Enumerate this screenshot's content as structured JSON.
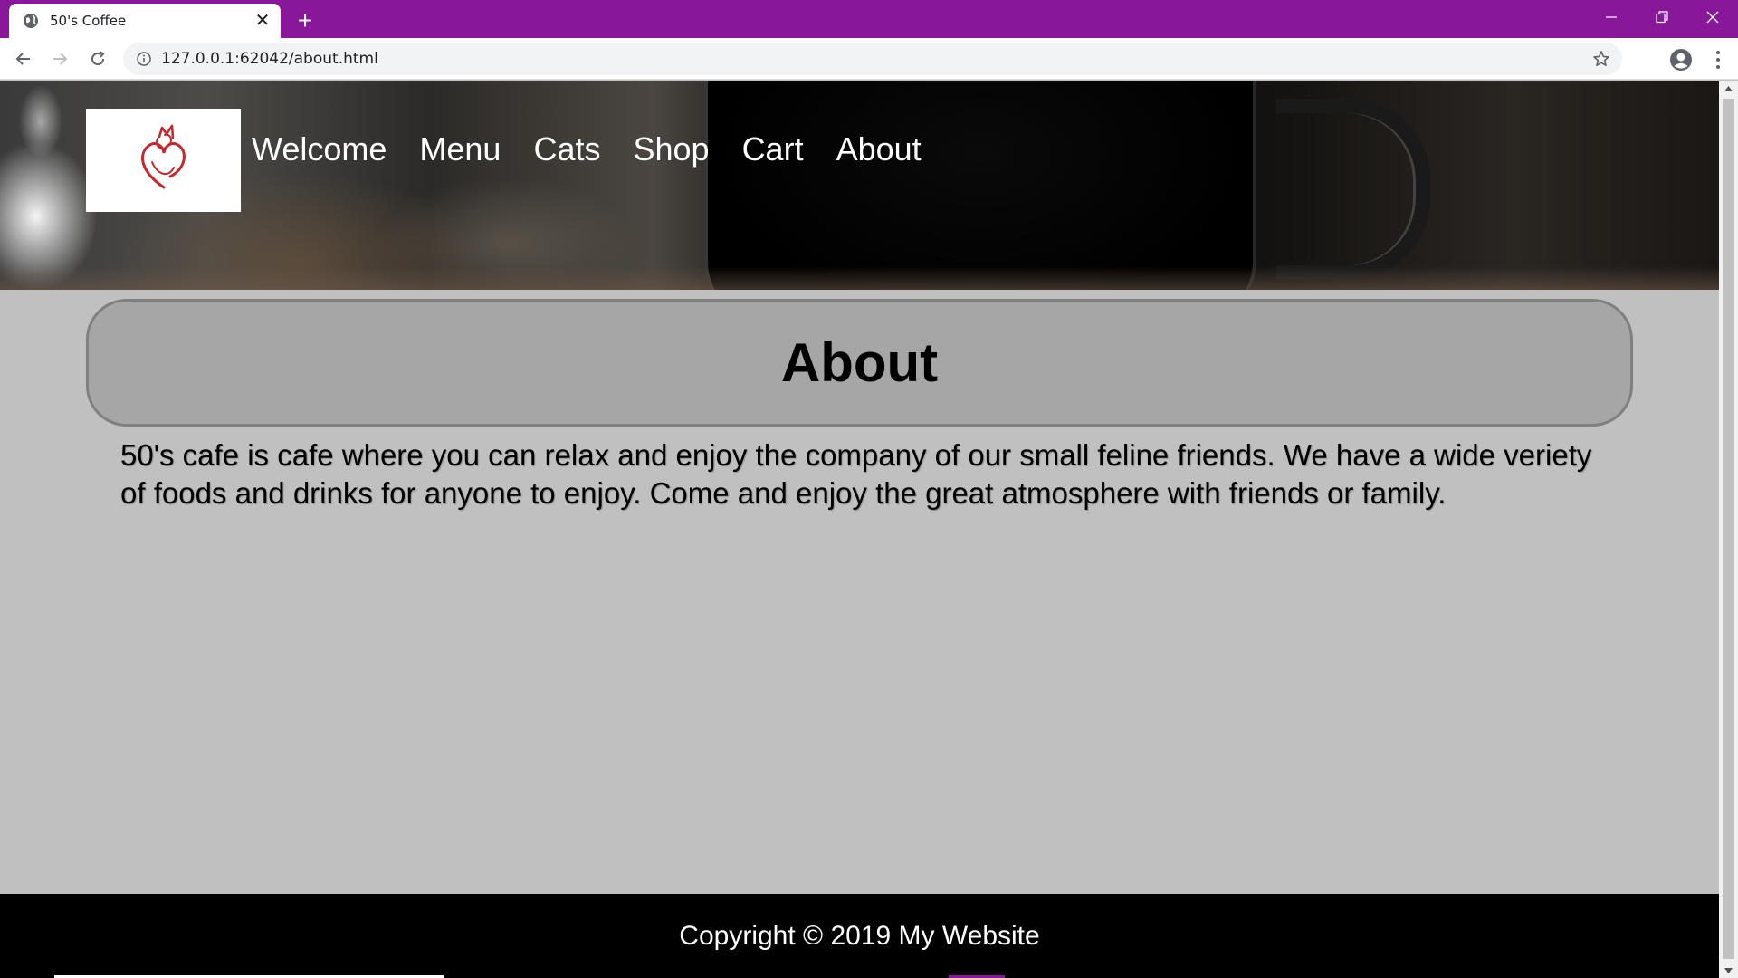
{
  "browser": {
    "tab_title": "50's Coffee",
    "tab_close": "✕",
    "new_tab": "+",
    "url": "127.0.0.1:62042/about.html",
    "accent_color": "#88179a"
  },
  "site": {
    "logo_icon": "cat-heart-logo-icon",
    "nav": [
      {
        "label": "Welcome"
      },
      {
        "label": "Menu"
      },
      {
        "label": "Cats"
      },
      {
        "label": "Shop"
      },
      {
        "label": "Cart"
      },
      {
        "label": "About"
      }
    ]
  },
  "main": {
    "heading": "About",
    "body": "50's cafe is cafe where you can relax and enjoy the company of our small feline friends. We have a wide veriety of foods and drinks for anyone to enjoy. Come and enjoy the great atmosphere with friends or family."
  },
  "footer": {
    "copyright": "Copyright © 2019 My Website"
  }
}
